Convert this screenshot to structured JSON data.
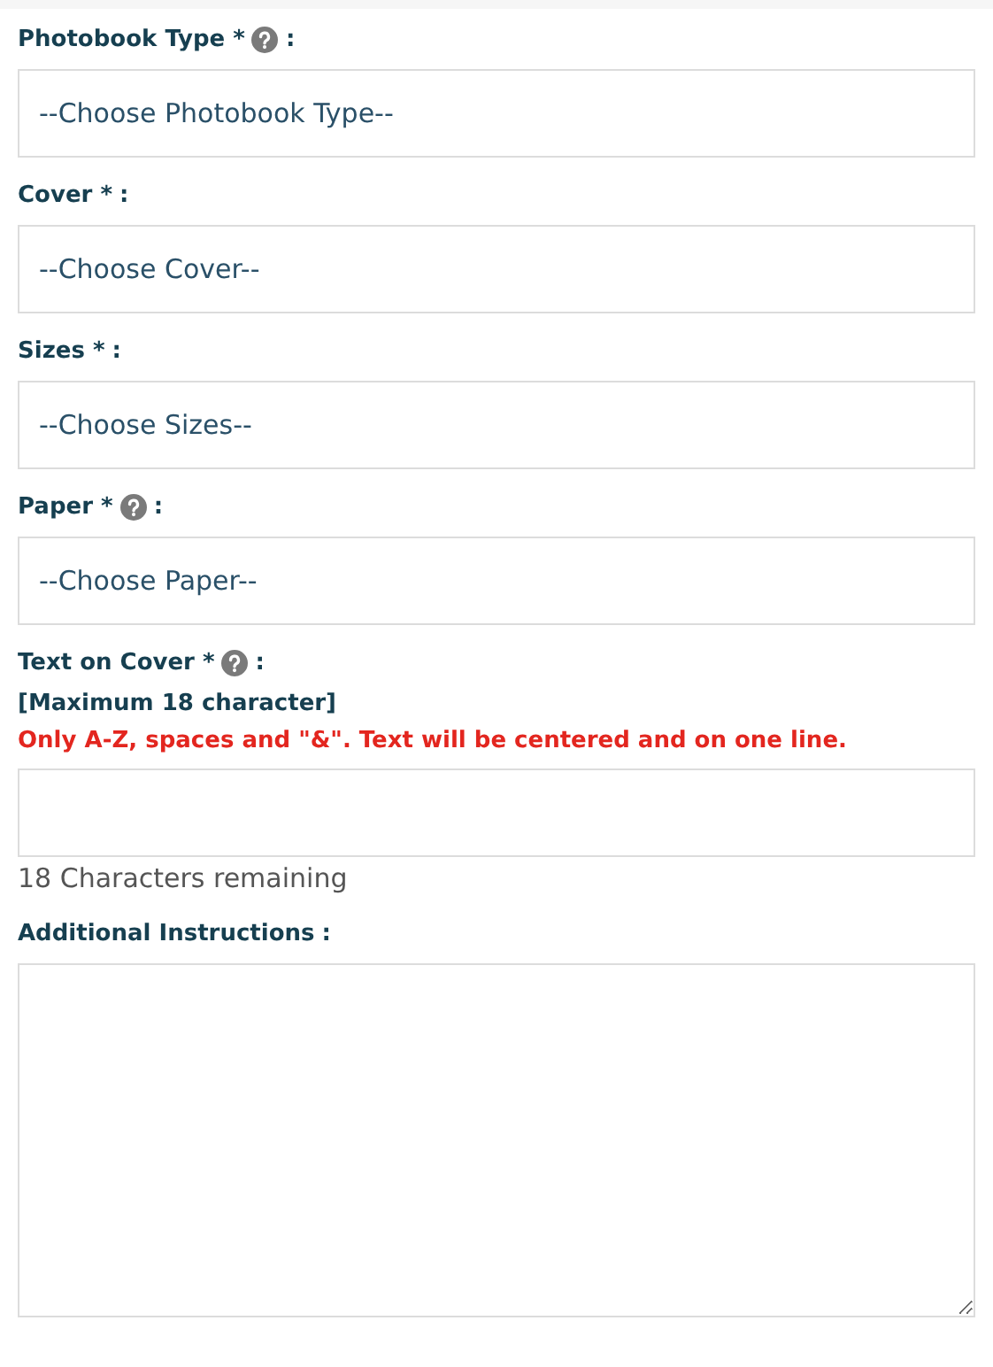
{
  "fields": [
    {
      "kind": "select",
      "label": "Photobook Type *",
      "help": true,
      "suffix": ":",
      "value": "--Choose Photobook Type--"
    },
    {
      "kind": "select",
      "label": "Cover *",
      "help": false,
      "suffix": ":",
      "value": "--Choose Cover--"
    },
    {
      "kind": "select",
      "label": "Sizes *",
      "help": false,
      "suffix": ":",
      "value": "--Choose Sizes--"
    },
    {
      "kind": "select",
      "label": "Paper *",
      "help": true,
      "suffix": ":",
      "value": "--Choose Paper--"
    },
    {
      "kind": "text",
      "label": "Text on Cover *",
      "help": true,
      "suffix": ":",
      "hint": "[Maximum 18 character]",
      "warning": "Only A-Z, spaces and \"&\". Text will be centered and on one line.",
      "counter": "18 Characters remaining"
    },
    {
      "kind": "textarea",
      "label": "Additional Instructions",
      "help": false,
      "suffix": ":"
    }
  ]
}
